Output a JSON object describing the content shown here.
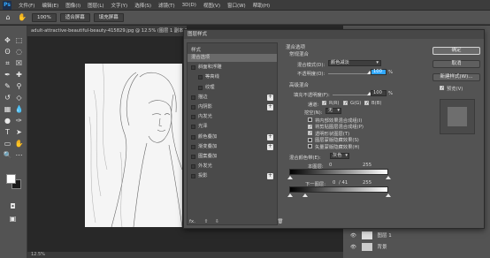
{
  "menubar": {
    "logo": "Ps",
    "items": [
      "文件(F)",
      "编辑(E)",
      "图像(I)",
      "图层(L)",
      "文字(Y)",
      "选择(S)",
      "滤镜(T)",
      "3D(D)",
      "视图(V)",
      "窗口(W)",
      "帮助(H)"
    ]
  },
  "options": {
    "zoom": "100%",
    "fit_screen": "适合屏幕",
    "fill_screen": "填充屏幕"
  },
  "document": {
    "tab_title": "adult-attractive-beautiful-beauty-415829.jpg @ 12.5% (图层 1 副本 2, RGB/8) *",
    "status_zoom": "12.5%"
  },
  "dialog": {
    "title": "图层样式",
    "styles_header": "样式",
    "style_items": [
      {
        "label": "混合选项",
        "checkbox": false,
        "plus": false,
        "selected": true,
        "indent": false
      },
      {
        "label": "斜面和浮雕",
        "checkbox": true,
        "plus": false,
        "selected": false,
        "indent": false
      },
      {
        "label": "等高线",
        "checkbox": true,
        "plus": false,
        "selected": false,
        "indent": true
      },
      {
        "label": "纹理",
        "checkbox": true,
        "plus": false,
        "selected": false,
        "indent": true
      },
      {
        "label": "描边",
        "checkbox": true,
        "plus": true,
        "selected": false,
        "indent": false
      },
      {
        "label": "内阴影",
        "checkbox": true,
        "plus": true,
        "selected": false,
        "indent": false
      },
      {
        "label": "内发光",
        "checkbox": true,
        "plus": false,
        "selected": false,
        "indent": false
      },
      {
        "label": "光泽",
        "checkbox": true,
        "plus": false,
        "selected": false,
        "indent": false
      },
      {
        "label": "颜色叠加",
        "checkbox": true,
        "plus": true,
        "selected": false,
        "indent": false
      },
      {
        "label": "渐变叠加",
        "checkbox": true,
        "plus": true,
        "selected": false,
        "indent": false
      },
      {
        "label": "图案叠加",
        "checkbox": true,
        "plus": false,
        "selected": false,
        "indent": false
      },
      {
        "label": "外发光",
        "checkbox": true,
        "plus": false,
        "selected": false,
        "indent": false
      },
      {
        "label": "投影",
        "checkbox": true,
        "plus": true,
        "selected": false,
        "indent": false
      }
    ],
    "fx_label": "fx.",
    "blending": {
      "section_title": "混合选项",
      "general_title": "常规混合",
      "blend_mode_label": "混合模式(D):",
      "blend_mode_value": "颜色减淡",
      "opacity_label": "不透明度(O):",
      "opacity_value": "100",
      "opacity_unit": "%",
      "advanced_title": "高级混合",
      "fill_opacity_label": "填充不透明度(F):",
      "fill_opacity_value": "100",
      "fill_opacity_unit": "%",
      "channels_label": "通道:",
      "channel_r": "R(R)",
      "channel_g": "G(G)",
      "channel_b": "B(B)",
      "knockout_label": "挖空(N):",
      "knockout_value": "无",
      "options": [
        {
          "label": "将内部效果混合成组(I)",
          "checked": false
        },
        {
          "label": "将剪贴图层混合成组(P)",
          "checked": true
        },
        {
          "label": "透明形状图层(T)",
          "checked": true
        },
        {
          "label": "图层蒙版隐藏效果(S)",
          "checked": false
        },
        {
          "label": "矢量蒙版隐藏效果(H)",
          "checked": false
        }
      ],
      "blend_if_label": "混合颜色带(E):",
      "blend_if_value": "灰色",
      "this_layer_label": "本图层:",
      "this_layer_low": "0",
      "this_layer_high": "255",
      "underlying_label": "下一图层:",
      "underlying_low": "0",
      "underlying_mid": "/ 41",
      "underlying_high": "255"
    },
    "buttons": {
      "ok": "确定",
      "cancel": "取消",
      "new_style": "新建样式(W)...",
      "preview": "预览(V)"
    }
  },
  "layers": {
    "rows": [
      {
        "label": "图层 1"
      },
      {
        "label": "背景"
      }
    ]
  },
  "colors": {
    "app_bg": "#282828",
    "panel": "#535353",
    "accent": "#31a8ff"
  }
}
